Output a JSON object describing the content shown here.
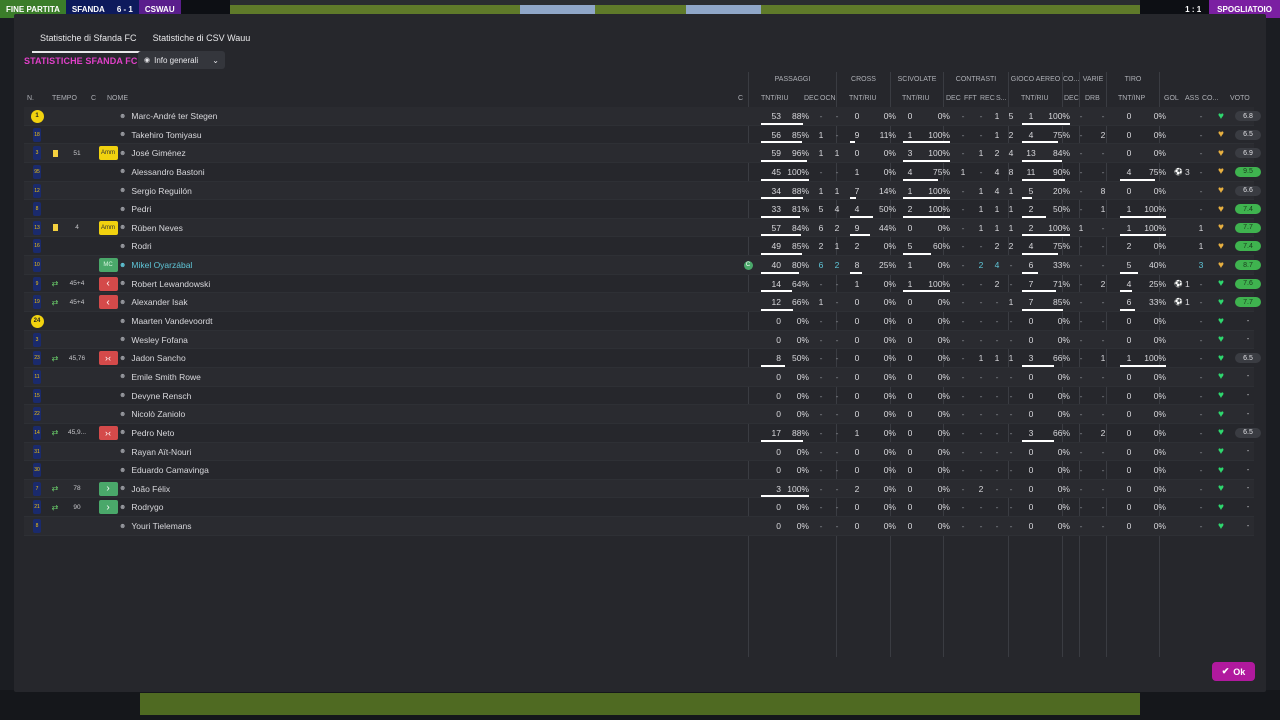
{
  "topbar": {
    "left_items": [
      "FINE PARTITA",
      "SFANDA",
      "6 - 1",
      "CSWAU"
    ],
    "right_score": "1 : 1",
    "right_action": "SPOGLIATOIO"
  },
  "tabs": [
    {
      "label": "Statistiche di Sfanda FC",
      "active": true
    },
    {
      "label": "Statistiche di CSV Wauu",
      "active": false
    }
  ],
  "title": "STATISTICHE SFANDA FC",
  "view_dropdown": {
    "label": "Info generali"
  },
  "group_headers": {
    "passaggi": "PASSAGGI",
    "cross": "CROSS",
    "scivolate": "SCIVOLATE",
    "contrasti": "CONTRASTI",
    "gioco_aereo": "GIOCO AEREO",
    "co": "CO...",
    "varie": "VARIE",
    "tiro": "TIRO"
  },
  "columns": {
    "n": "N.",
    "tempo": "TEMPO",
    "c": "C",
    "nome": "NOME",
    "c2": "C",
    "pass_tnt": "TNT/RIU",
    "pass_dec": "DEC",
    "pass_ocn": "OCN",
    "cross_tnt": "TNT/RIU",
    "sciv_tnt": "TNT/RIU",
    "contr_dec": "DEC",
    "contr_fft": "FFT",
    "contr_rec": "REC",
    "contr_s": "S...",
    "aereo_tnt": "TNT/RIU",
    "co_dec": "DEC",
    "varie_drb": "DRB",
    "tiro_tnt": "TNT/INP",
    "gol": "GOL",
    "ass": "ASS",
    "co2": "CO...",
    "voto": "VOTO"
  },
  "players": [
    {
      "n": "1",
      "gk": true,
      "tempo": "",
      "card": false,
      "sub": "",
      "badge": "",
      "name": "Marc-André ter Stegen",
      "pass": [
        "53",
        "88%"
      ],
      "dec": "-",
      "ocn": "-",
      "cross": [
        "0",
        "0%"
      ],
      "sciv": [
        "0",
        "0%"
      ],
      "cdec": "-",
      "fft": "-",
      "rec": "1",
      "s": "5",
      "aereo": [
        "1",
        "100%"
      ],
      "codec": "-",
      "drb": "-",
      "tiro": [
        "0",
        "0%"
      ],
      "gol": "",
      "ass": "-",
      "mood": "g",
      "voto": "6.8",
      "vg": false
    },
    {
      "n": "18",
      "gk": false,
      "tempo": "",
      "card": false,
      "sub": "",
      "badge": "",
      "name": "Takehiro Tomiyasu",
      "pass": [
        "56",
        "85%"
      ],
      "dec": "1",
      "ocn": "-",
      "cross": [
        "9",
        "11%"
      ],
      "sciv": [
        "1",
        "100%"
      ],
      "cdec": "-",
      "fft": "-",
      "rec": "1",
      "s": "2",
      "aereo": [
        "4",
        "75%"
      ],
      "codec": "-",
      "drb": "2",
      "tiro": [
        "0",
        "0%"
      ],
      "gol": "",
      "ass": "-",
      "mood": "o",
      "voto": "6.5",
      "vg": false
    },
    {
      "n": "3",
      "gk": false,
      "tempo": "51",
      "card": true,
      "sub": "",
      "badge": "Amm",
      "name": "José Giménez",
      "pass": [
        "59",
        "96%"
      ],
      "dec": "1",
      "ocn": "1",
      "cross": [
        "0",
        "0%"
      ],
      "sciv": [
        "3",
        "100%"
      ],
      "cdec": "-",
      "fft": "1",
      "rec": "2",
      "s": "4",
      "aereo": [
        "13",
        "84%"
      ],
      "codec": "-",
      "drb": "-",
      "tiro": [
        "0",
        "0%"
      ],
      "gol": "",
      "ass": "-",
      "mood": "o",
      "voto": "6.9",
      "vg": false
    },
    {
      "n": "95",
      "gk": false,
      "tempo": "",
      "card": false,
      "sub": "",
      "badge": "",
      "name": "Alessandro Bastoni",
      "pass": [
        "45",
        "100%"
      ],
      "dec": "-",
      "ocn": "-",
      "cross": [
        "1",
        "0%"
      ],
      "sciv": [
        "4",
        "75%"
      ],
      "cdec": "1",
      "fft": "-",
      "rec": "4",
      "s": "8",
      "aereo": [
        "11",
        "90%"
      ],
      "codec": "-",
      "drb": "-",
      "tiro": [
        "4",
        "75%"
      ],
      "gol": "3",
      "ass": "-",
      "mood": "o",
      "voto": "9.5",
      "vg": true
    },
    {
      "n": "12",
      "gk": false,
      "tempo": "",
      "card": false,
      "sub": "",
      "badge": "",
      "name": "Sergio Reguilón",
      "pass": [
        "34",
        "88%"
      ],
      "dec": "1",
      "ocn": "1",
      "cross": [
        "7",
        "14%"
      ],
      "sciv": [
        "1",
        "100%"
      ],
      "cdec": "-",
      "fft": "1",
      "rec": "4",
      "s": "1",
      "aereo": [
        "5",
        "20%"
      ],
      "codec": "-",
      "drb": "8",
      "tiro": [
        "0",
        "0%"
      ],
      "gol": "",
      "ass": "-",
      "mood": "o",
      "voto": "6.6",
      "vg": false
    },
    {
      "n": "8",
      "gk": false,
      "tempo": "",
      "card": false,
      "sub": "",
      "badge": "",
      "name": "Pedri",
      "pass": [
        "33",
        "81%"
      ],
      "dec": "5",
      "ocn": "4",
      "cross": [
        "4",
        "50%"
      ],
      "sciv": [
        "2",
        "100%"
      ],
      "cdec": "-",
      "fft": "1",
      "rec": "1",
      "s": "1",
      "aereo": [
        "2",
        "50%"
      ],
      "codec": "-",
      "drb": "1",
      "tiro": [
        "1",
        "100%"
      ],
      "gol": "",
      "ass": "-",
      "mood": "o",
      "voto": "7.4",
      "vg": true
    },
    {
      "n": "13",
      "gk": false,
      "tempo": "4",
      "card": true,
      "sub": "",
      "badge": "Amm",
      "name": "Rúben Neves",
      "pass": [
        "57",
        "84%"
      ],
      "dec": "6",
      "ocn": "2",
      "cross": [
        "9",
        "44%"
      ],
      "sciv": [
        "0",
        "0%"
      ],
      "cdec": "-",
      "fft": "1",
      "rec": "1",
      "s": "1",
      "aereo": [
        "2",
        "100%"
      ],
      "codec": "1",
      "drb": "-",
      "tiro": [
        "1",
        "100%"
      ],
      "gol": "",
      "ass": "1",
      "mood": "o",
      "voto": "7.7",
      "vg": true
    },
    {
      "n": "16",
      "gk": false,
      "tempo": "",
      "card": false,
      "sub": "",
      "badge": "",
      "name": "Rodri",
      "pass": [
        "49",
        "85%"
      ],
      "dec": "2",
      "ocn": "1",
      "cross": [
        "2",
        "0%"
      ],
      "sciv": [
        "5",
        "60%"
      ],
      "cdec": "-",
      "fft": "-",
      "rec": "2",
      "s": "2",
      "aereo": [
        "4",
        "75%"
      ],
      "codec": "-",
      "drb": "-",
      "tiro": [
        "2",
        "0%"
      ],
      "gol": "",
      "ass": "1",
      "mood": "o",
      "voto": "7.4",
      "vg": true
    },
    {
      "n": "10",
      "gk": false,
      "tempo": "",
      "card": false,
      "sub": "",
      "badge": "MC",
      "name": "Mikel Oyarzábal",
      "captain": true,
      "pass": [
        "40",
        "80%"
      ],
      "dec": "6",
      "ocn": "2",
      "cross": [
        "8",
        "25%"
      ],
      "sciv": [
        "1",
        "0%"
      ],
      "cdec": "-",
      "fft": "2",
      "rec": "4",
      "s": "-",
      "aereo": [
        "6",
        "33%"
      ],
      "codec": "-",
      "drb": "-",
      "tiro": [
        "5",
        "40%"
      ],
      "gol": "",
      "ass": "3",
      "mood": "o",
      "voto": "8.7",
      "vg": true
    },
    {
      "n": "9",
      "gk": false,
      "tempo": "45+4",
      "card": false,
      "sub": "both",
      "badge": "out",
      "name": "Robert Lewandowski",
      "pass": [
        "14",
        "64%"
      ],
      "dec": "-",
      "ocn": "-",
      "cross": [
        "1",
        "0%"
      ],
      "sciv": [
        "1",
        "100%"
      ],
      "cdec": "-",
      "fft": "-",
      "rec": "2",
      "s": "-",
      "aereo": [
        "7",
        "71%"
      ],
      "codec": "-",
      "drb": "2",
      "tiro": [
        "4",
        "25%"
      ],
      "gol": "1",
      "ass": "-",
      "mood": "g",
      "voto": "7.6",
      "vg": true
    },
    {
      "n": "19",
      "gk": false,
      "tempo": "45+4",
      "card": false,
      "sub": "both",
      "badge": "out",
      "name": "Alexander Isak",
      "pass": [
        "12",
        "66%"
      ],
      "dec": "1",
      "ocn": "-",
      "cross": [
        "0",
        "0%"
      ],
      "sciv": [
        "0",
        "0%"
      ],
      "cdec": "-",
      "fft": "-",
      "rec": "-",
      "s": "1",
      "aereo": [
        "7",
        "85%"
      ],
      "codec": "-",
      "drb": "-",
      "tiro": [
        "6",
        "33%"
      ],
      "gol": "1",
      "ass": "-",
      "mood": "g",
      "voto": "7.7",
      "vg": true
    },
    {
      "n": "24",
      "gk": true,
      "tempo": "",
      "card": false,
      "sub": "",
      "badge": "",
      "name": "Maarten Vandevoordt",
      "pass": [
        "0",
        "0%"
      ],
      "dec": "-",
      "ocn": "-",
      "cross": [
        "0",
        "0%"
      ],
      "sciv": [
        "0",
        "0%"
      ],
      "cdec": "-",
      "fft": "-",
      "rec": "-",
      "s": "-",
      "aereo": [
        "0",
        "0%"
      ],
      "codec": "-",
      "drb": "-",
      "tiro": [
        "0",
        "0%"
      ],
      "gol": "",
      "ass": "-",
      "mood": "g",
      "voto": "-",
      "vg": false
    },
    {
      "n": "3",
      "gk": false,
      "tempo": "",
      "card": false,
      "sub": "",
      "badge": "",
      "name": "Wesley Fofana",
      "pass": [
        "0",
        "0%"
      ],
      "dec": "-",
      "ocn": "-",
      "cross": [
        "0",
        "0%"
      ],
      "sciv": [
        "0",
        "0%"
      ],
      "cdec": "-",
      "fft": "-",
      "rec": "-",
      "s": "-",
      "aereo": [
        "0",
        "0%"
      ],
      "codec": "-",
      "drb": "-",
      "tiro": [
        "0",
        "0%"
      ],
      "gol": "",
      "ass": "-",
      "mood": "g",
      "voto": "-",
      "vg": false
    },
    {
      "n": "23",
      "gk": false,
      "tempo": "45,76",
      "card": false,
      "sub": "both",
      "badge": "both",
      "name": "Jadon Sancho",
      "pass": [
        "8",
        "50%"
      ],
      "dec": "-",
      "ocn": "-",
      "cross": [
        "0",
        "0%"
      ],
      "sciv": [
        "0",
        "0%"
      ],
      "cdec": "-",
      "fft": "1",
      "rec": "1",
      "s": "1",
      "aereo": [
        "3",
        "66%"
      ],
      "codec": "-",
      "drb": "1",
      "tiro": [
        "1",
        "100%"
      ],
      "gol": "",
      "ass": "-",
      "mood": "g",
      "voto": "6.5",
      "vg": false
    },
    {
      "n": "11",
      "gk": false,
      "tempo": "",
      "card": false,
      "sub": "",
      "badge": "",
      "name": "Emile Smith Rowe",
      "pass": [
        "0",
        "0%"
      ],
      "dec": "-",
      "ocn": "-",
      "cross": [
        "0",
        "0%"
      ],
      "sciv": [
        "0",
        "0%"
      ],
      "cdec": "-",
      "fft": "-",
      "rec": "-",
      "s": "-",
      "aereo": [
        "0",
        "0%"
      ],
      "codec": "-",
      "drb": "-",
      "tiro": [
        "0",
        "0%"
      ],
      "gol": "",
      "ass": "-",
      "mood": "g",
      "voto": "-",
      "vg": false
    },
    {
      "n": "15",
      "gk": false,
      "tempo": "",
      "card": false,
      "sub": "",
      "badge": "",
      "name": "Devyne Rensch",
      "pass": [
        "0",
        "0%"
      ],
      "dec": "-",
      "ocn": "-",
      "cross": [
        "0",
        "0%"
      ],
      "sciv": [
        "0",
        "0%"
      ],
      "cdec": "-",
      "fft": "-",
      "rec": "-",
      "s": "-",
      "aereo": [
        "0",
        "0%"
      ],
      "codec": "-",
      "drb": "-",
      "tiro": [
        "0",
        "0%"
      ],
      "gol": "",
      "ass": "-",
      "mood": "g",
      "voto": "-",
      "vg": false
    },
    {
      "n": "22",
      "gk": false,
      "tempo": "",
      "card": false,
      "sub": "",
      "badge": "",
      "name": "Nicolò Zaniolo",
      "pass": [
        "0",
        "0%"
      ],
      "dec": "-",
      "ocn": "-",
      "cross": [
        "0",
        "0%"
      ],
      "sciv": [
        "0",
        "0%"
      ],
      "cdec": "-",
      "fft": "-",
      "rec": "-",
      "s": "-",
      "aereo": [
        "0",
        "0%"
      ],
      "codec": "-",
      "drb": "-",
      "tiro": [
        "0",
        "0%"
      ],
      "gol": "",
      "ass": "-",
      "mood": "g",
      "voto": "-",
      "vg": false
    },
    {
      "n": "14",
      "gk": false,
      "tempo": "45,9...",
      "card": false,
      "sub": "both",
      "badge": "both",
      "name": "Pedro Neto",
      "pass": [
        "17",
        "88%"
      ],
      "dec": "-",
      "ocn": "-",
      "cross": [
        "1",
        "0%"
      ],
      "sciv": [
        "0",
        "0%"
      ],
      "cdec": "-",
      "fft": "-",
      "rec": "-",
      "s": "-",
      "aereo": [
        "3",
        "66%"
      ],
      "codec": "-",
      "drb": "2",
      "tiro": [
        "0",
        "0%"
      ],
      "gol": "",
      "ass": "-",
      "mood": "g",
      "voto": "6.5",
      "vg": false
    },
    {
      "n": "31",
      "gk": false,
      "tempo": "",
      "card": false,
      "sub": "",
      "badge": "",
      "name": "Rayan Aït-Nouri",
      "pass": [
        "0",
        "0%"
      ],
      "dec": "-",
      "ocn": "-",
      "cross": [
        "0",
        "0%"
      ],
      "sciv": [
        "0",
        "0%"
      ],
      "cdec": "-",
      "fft": "-",
      "rec": "-",
      "s": "-",
      "aereo": [
        "0",
        "0%"
      ],
      "codec": "-",
      "drb": "-",
      "tiro": [
        "0",
        "0%"
      ],
      "gol": "",
      "ass": "-",
      "mood": "g",
      "voto": "-",
      "vg": false
    },
    {
      "n": "30",
      "gk": false,
      "tempo": "",
      "card": false,
      "sub": "",
      "badge": "",
      "name": "Eduardo Camavinga",
      "pass": [
        "0",
        "0%"
      ],
      "dec": "-",
      "ocn": "-",
      "cross": [
        "0",
        "0%"
      ],
      "sciv": [
        "0",
        "0%"
      ],
      "cdec": "-",
      "fft": "-",
      "rec": "-",
      "s": "-",
      "aereo": [
        "0",
        "0%"
      ],
      "codec": "-",
      "drb": "-",
      "tiro": [
        "0",
        "0%"
      ],
      "gol": "",
      "ass": "-",
      "mood": "g",
      "voto": "-",
      "vg": false
    },
    {
      "n": "7",
      "gk": false,
      "tempo": "78",
      "card": false,
      "sub": "in",
      "badge": "in",
      "name": "João Félix",
      "pass": [
        "3",
        "100%"
      ],
      "dec": "-",
      "ocn": "-",
      "cross": [
        "2",
        "0%"
      ],
      "sciv": [
        "0",
        "0%"
      ],
      "cdec": "-",
      "fft": "2",
      "rec": "-",
      "s": "-",
      "aereo": [
        "0",
        "0%"
      ],
      "codec": "-",
      "drb": "-",
      "tiro": [
        "0",
        "0%"
      ],
      "gol": "",
      "ass": "-",
      "mood": "g",
      "voto": "-",
      "vg": false
    },
    {
      "n": "21",
      "gk": false,
      "tempo": "90",
      "card": false,
      "sub": "in",
      "badge": "in",
      "name": "Rodrygo",
      "pass": [
        "0",
        "0%"
      ],
      "dec": "-",
      "ocn": "-",
      "cross": [
        "0",
        "0%"
      ],
      "sciv": [
        "0",
        "0%"
      ],
      "cdec": "-",
      "fft": "-",
      "rec": "-",
      "s": "-",
      "aereo": [
        "0",
        "0%"
      ],
      "codec": "-",
      "drb": "-",
      "tiro": [
        "0",
        "0%"
      ],
      "gol": "",
      "ass": "-",
      "mood": "g",
      "voto": "-",
      "vg": false
    },
    {
      "n": "8",
      "gk": false,
      "tempo": "",
      "card": false,
      "sub": "",
      "badge": "",
      "name": "Youri Tielemans",
      "pass": [
        "0",
        "0%"
      ],
      "dec": "-",
      "ocn": "-",
      "cross": [
        "0",
        "0%"
      ],
      "sciv": [
        "0",
        "0%"
      ],
      "cdec": "-",
      "fft": "-",
      "rec": "-",
      "s": "-",
      "aereo": [
        "0",
        "0%"
      ],
      "codec": "-",
      "drb": "-",
      "tiro": [
        "0",
        "0%"
      ],
      "gol": "",
      "ass": "-",
      "mood": "g",
      "voto": "-",
      "vg": false
    }
  ],
  "ok_label": "Ok",
  "colors": {
    "accent": "#e040c8",
    "ok": "#b1199e",
    "vote_good": "#3fb34f",
    "mood_good": "#2ed86e",
    "mood_ok": "#e8b040",
    "card_yellow": "#f4d03f"
  }
}
